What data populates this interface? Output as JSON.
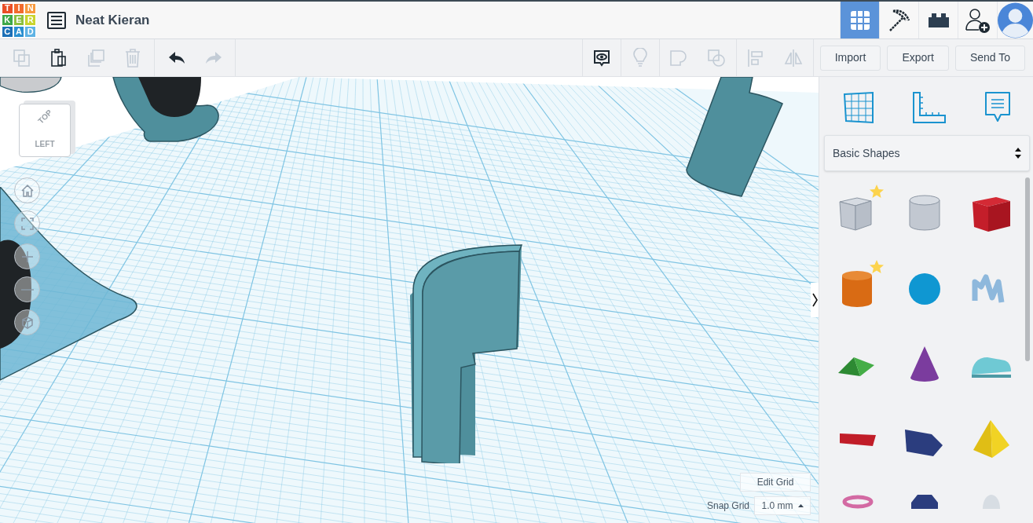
{
  "logo": {
    "tiles": [
      {
        "letter": "T",
        "color": "#e94e26"
      },
      {
        "letter": "I",
        "color": "#f26b2d"
      },
      {
        "letter": "N",
        "color": "#f79a3e"
      },
      {
        "letter": "K",
        "color": "#3fa84a"
      },
      {
        "letter": "E",
        "color": "#8cc03f"
      },
      {
        "letter": "R",
        "color": "#c9d42e"
      },
      {
        "letter": "C",
        "color": "#1b6fb6"
      },
      {
        "letter": "A",
        "color": "#2a8fd0"
      },
      {
        "letter": "D",
        "color": "#5fb3e4"
      }
    ]
  },
  "project_title": "Neat Kieran",
  "view_buttons": [
    {
      "kind": "grid",
      "selected": true
    },
    {
      "kind": "pickaxe",
      "selected": false
    },
    {
      "kind": "brick",
      "selected": false
    },
    {
      "kind": "add-user",
      "selected": false
    },
    {
      "kind": "avatar",
      "selected": false
    }
  ],
  "edit_tools": [
    {
      "kind": "copy",
      "disabled": true
    },
    {
      "kind": "paste",
      "disabled": false
    },
    {
      "kind": "duplicate",
      "disabled": true
    },
    {
      "kind": "delete",
      "disabled": true
    }
  ],
  "history_tools": [
    {
      "kind": "undo",
      "disabled": false
    },
    {
      "kind": "redo",
      "disabled": true
    }
  ],
  "shape_tools": [
    {
      "kind": "notes",
      "disabled": false
    },
    {
      "kind": "light",
      "disabled": true
    },
    {
      "kind": "group",
      "disabled": true
    },
    {
      "kind": "ungroup",
      "disabled": true
    },
    {
      "kind": "align",
      "disabled": true
    },
    {
      "kind": "mirror",
      "disabled": true
    }
  ],
  "action_buttons": [
    "Import",
    "Export",
    "Send To"
  ],
  "view_cube": {
    "top": "TOP",
    "left": "LEFT"
  },
  "nav_buttons": [
    {
      "kind": "home"
    },
    {
      "kind": "fit"
    },
    {
      "kind": "zoom-in"
    },
    {
      "kind": "zoom-out"
    },
    {
      "kind": "perspective"
    }
  ],
  "grid_controls": {
    "edit_grid": "Edit Grid",
    "snap_label": "Snap Grid",
    "snap_value": "1.0 mm"
  },
  "panel": {
    "tabs": [
      {
        "kind": "workplane"
      },
      {
        "kind": "ruler"
      },
      {
        "kind": "notes"
      }
    ],
    "library": "Basic Shapes",
    "shapes": [
      {
        "kind": "hole-box",
        "starred": true
      },
      {
        "kind": "hole-cylinder",
        "starred": false
      },
      {
        "kind": "box",
        "starred": false
      },
      {
        "kind": "cylinder",
        "starred": true
      },
      {
        "kind": "sphere",
        "starred": false
      },
      {
        "kind": "scribble",
        "starred": false
      },
      {
        "kind": "roof",
        "starred": false
      },
      {
        "kind": "cone",
        "starred": false
      },
      {
        "kind": "round-roof",
        "starred": false
      },
      {
        "kind": "text",
        "starred": false
      },
      {
        "kind": "polygon",
        "starred": false
      },
      {
        "kind": "pyramid",
        "starred": false
      },
      {
        "kind": "torus",
        "starred": false
      },
      {
        "kind": "hexagon",
        "starred": false
      },
      {
        "kind": "egg",
        "starred": false
      }
    ]
  }
}
